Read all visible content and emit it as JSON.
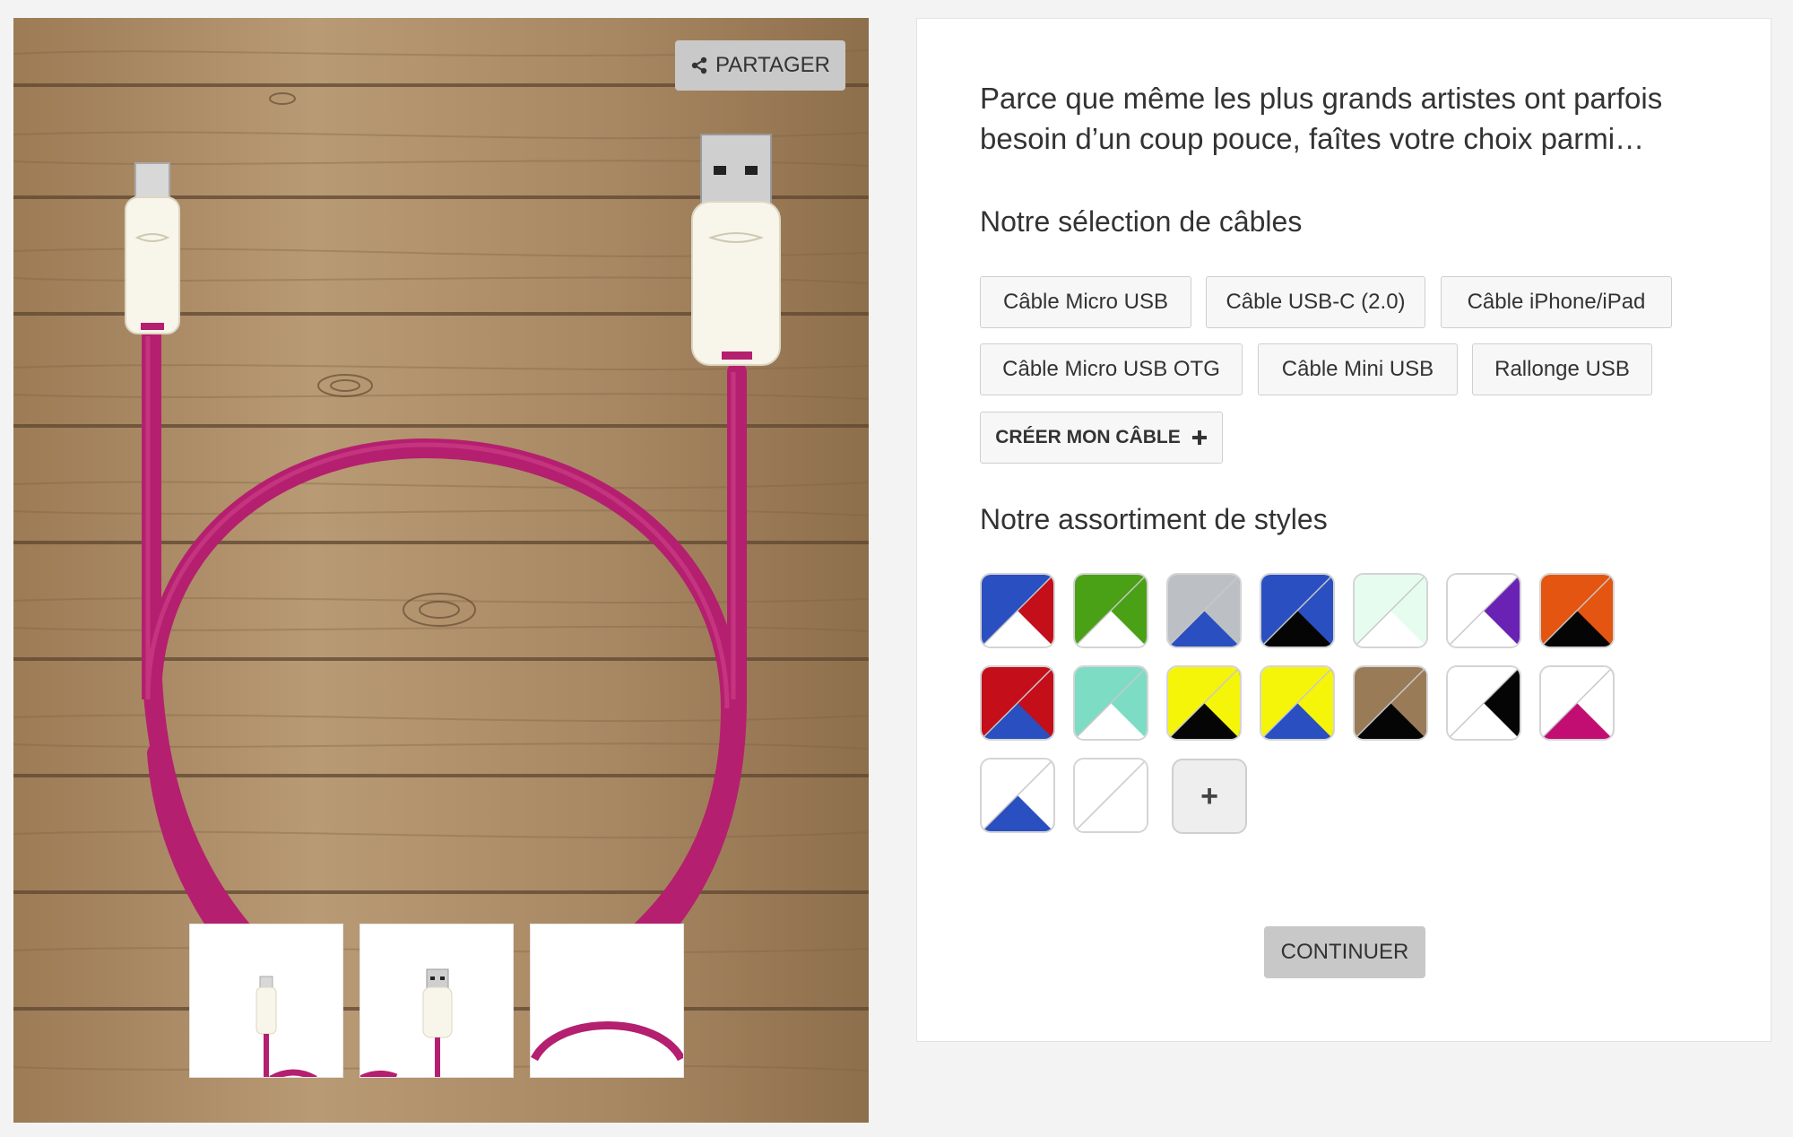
{
  "viewer": {
    "share_label": "PARTAGER",
    "share_icon": "share-icon",
    "cable_color": "#b51f6f",
    "connector_color": "#f8f5ea"
  },
  "panel": {
    "intro": "Parce que même les plus grands artistes ont parfois besoin d’un coup pouce, faîtes votre choix parmi…",
    "cables_title": "Notre sélection de câbles",
    "cable_options": [
      "Câble Micro USB",
      "Câble USB-C (2.0)",
      "Câble iPhone/iPad",
      "Câble Micro USB OTG",
      "Câble Mini USB",
      "Rallonge USB"
    ],
    "create_label": "CRÉER MON CÂBLE",
    "create_icon": "plus-icon",
    "styles_title": "Notre assortiment de styles",
    "styles": [
      {
        "a": "#2a4fc0",
        "b": "#ffffff",
        "c": "#c40e1a"
      },
      {
        "a": "#4aa116",
        "b": "#ffffff",
        "c": "#4aa116"
      },
      {
        "a": "#bcc0c4",
        "b": "#2a4fc0",
        "c": "#bcc0c4"
      },
      {
        "a": "#2a4fc0",
        "b": "#050505",
        "c": "#2a4fc0"
      },
      {
        "a": "#e6fcef",
        "b": "#ffffff",
        "c": "#e6fcef"
      },
      {
        "a": "#ffffff",
        "b": "#ffffff",
        "c": "#6a22b4"
      },
      {
        "a": "#e35510",
        "b": "#050505",
        "c": "#e35510"
      },
      {
        "a": "#c40e1a",
        "b": "#2a4fc0",
        "c": "#c40e1a"
      },
      {
        "a": "#7cdcc4",
        "b": "#ffffff",
        "c": "#7cdcc4"
      },
      {
        "a": "#f5f50a",
        "b": "#050505",
        "c": "#f5f50a"
      },
      {
        "a": "#f5f50a",
        "b": "#2a4fc0",
        "c": "#f5f50a"
      },
      {
        "a": "#9a7b58",
        "b": "#050505",
        "c": "#9a7b58"
      },
      {
        "a": "#ffffff",
        "b": "#ffffff",
        "c": "#050505"
      },
      {
        "a": "#ffffff",
        "b": "#c20e72",
        "c": "#ffffff"
      },
      {
        "a": "#ffffff",
        "b": "#2a4fc0",
        "c": "#ffffff"
      },
      {
        "a": "#ffffff",
        "b": "#ffffff",
        "c": "#ffffff"
      }
    ],
    "add_style_label": "+",
    "continue_label": "CONTINUER"
  }
}
